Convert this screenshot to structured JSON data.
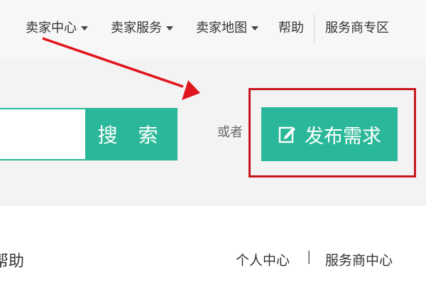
{
  "topnav": {
    "items": [
      {
        "label": "卖家中心",
        "dropdown": true
      },
      {
        "label": "卖家服务",
        "dropdown": true
      },
      {
        "label": "卖家地图",
        "dropdown": true
      },
      {
        "label": "帮助",
        "dropdown": false
      },
      {
        "label": "服务商专区",
        "dropdown": false
      }
    ]
  },
  "search": {
    "input_value": "",
    "button_label": "搜 索"
  },
  "or_label": "或者",
  "publish": {
    "label": "发布需求",
    "icon": "edit-icon"
  },
  "bottom": {
    "left_fragment": "帮助",
    "links": [
      "个人中心",
      "服务商中心"
    ],
    "separator": "|"
  },
  "colors": {
    "accent_green": "#2bb89a",
    "highlight_red": "#c8161e",
    "arrow_red": "#e0161e"
  }
}
